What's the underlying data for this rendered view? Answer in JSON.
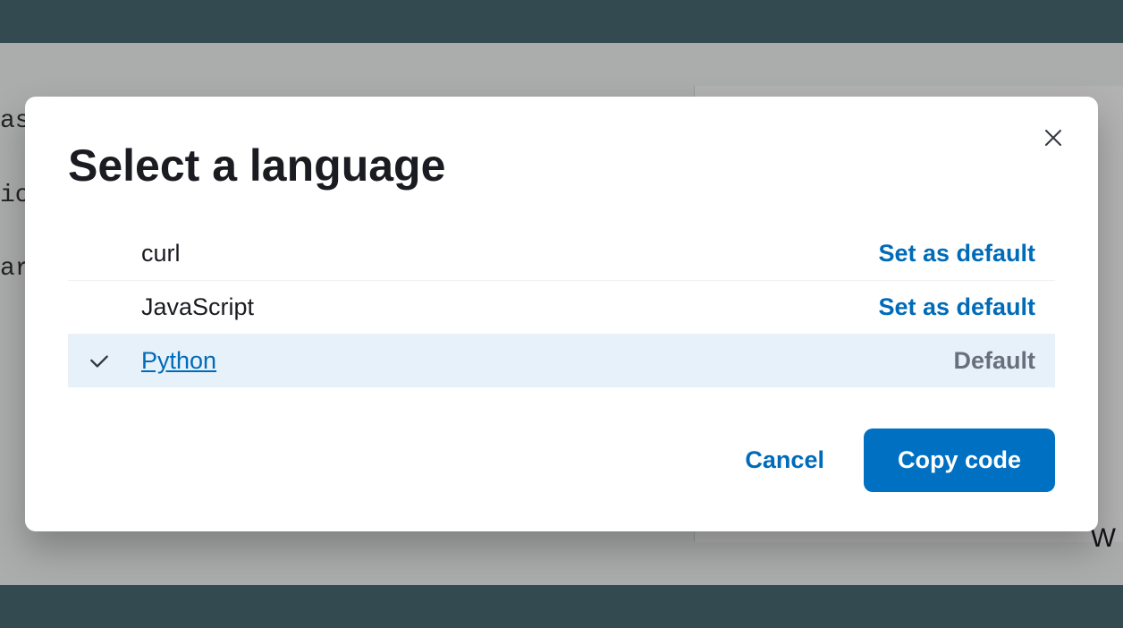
{
  "background": {
    "line1": "asticsearch API. See the Elasticsearch API",
    "line2": "ic",
    "line3": "ar",
    "char": "W"
  },
  "modal": {
    "title": "Select a language",
    "rows": [
      {
        "name": "curl",
        "action": "Set as default",
        "selected": false,
        "is_default": false
      },
      {
        "name": "JavaScript",
        "action": "Set as default",
        "selected": false,
        "is_default": false
      },
      {
        "name": "Python",
        "action": "Default",
        "selected": true,
        "is_default": true
      }
    ],
    "cancel_label": "Cancel",
    "primary_label": "Copy code"
  }
}
